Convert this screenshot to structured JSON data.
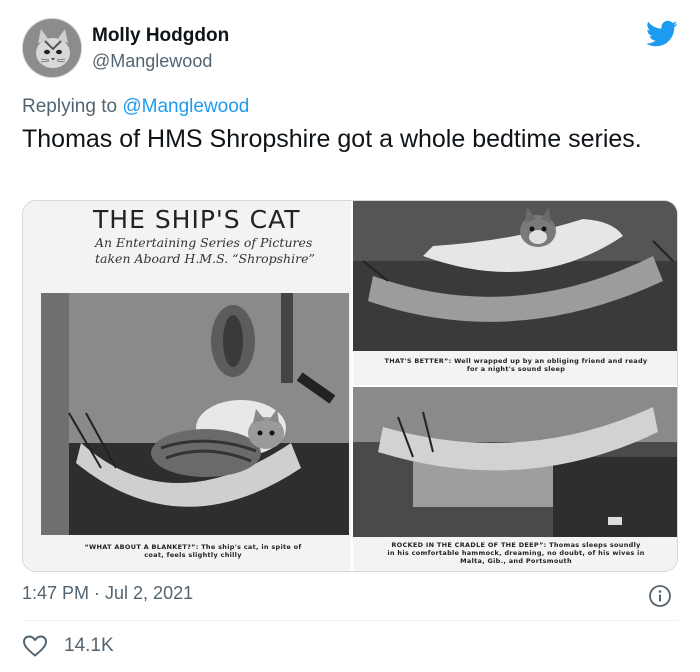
{
  "author": {
    "name": "Molly Hodgdon",
    "handle": "@Manglewood",
    "avatar_icon": "cat-avatar"
  },
  "reply": {
    "prefix": "Replying to ",
    "mention": "@Manglewood"
  },
  "tweet": {
    "text": "Thomas of HMS Shropshire got a whole bedtime series."
  },
  "media": {
    "page_title": "THE SHIP'S CAT",
    "page_subtitle_line1": "An Entertaining Series of Pictures",
    "page_subtitle_line2": "taken Aboard H.M.S. “Shropshire”",
    "captions": {
      "left_line1": "“WHAT ABOUT A BLANKET?”: The ship's cat, in spite of",
      "left_line2": "coat, feels slightly chilly",
      "top_right_line1": "THAT'S BETTER”: Well wrapped up by an obliging friend and ready",
      "top_right_line2": "for a night's sound sleep",
      "bottom_right_line1": "ROCKED IN THE CRADLE OF THE DEEP”: Thomas sleeps soundly",
      "bottom_right_line2": "in his comfortable hammock, dreaming, no doubt, of his wives in",
      "bottom_right_line3": "Malta, Gib., and Portsmouth"
    }
  },
  "meta": {
    "timestamp": "1:47 PM · Jul 2, 2021",
    "likes": "14.1K"
  },
  "colors": {
    "twitter_blue": "#1d9bf0",
    "secondary_text": "#536471"
  }
}
